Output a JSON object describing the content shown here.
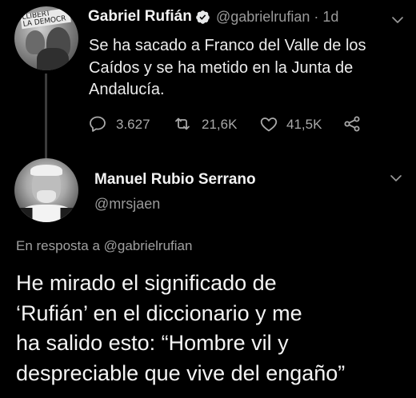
{
  "original_tweet": {
    "author_name": "Gabriel Rufián",
    "handle": "@gabrielrufian",
    "time_separator": "·",
    "timestamp": "1d",
    "avatar_banner_text": "LLIBERT\nLA DEMOCR",
    "text_lines": [
      "Se ha sacado a Franco del Valle de los",
      "Caídos y se ha metido en la Junta de",
      "Andalucía."
    ],
    "actions": {
      "reply_count": "3.627",
      "retweet_count": "21,6K",
      "like_count": "41,5K"
    },
    "icons": [
      "verified-badge-icon",
      "chevron-down-icon",
      "reply-icon",
      "retweet-icon",
      "heart-icon",
      "share-icon"
    ]
  },
  "reply_tweet": {
    "author_name": "Manuel Rubio Serrano",
    "handle": "@mrsjaen",
    "replying_to_label": "En resposta a",
    "replying_to_handle": "@gabrielrufian",
    "text_lines": [
      "He mirado el significado de",
      "‘Rufián’ en el diccionario y me",
      "ha salido esto: “Hombre vil y",
      "despreciable que vive del engaño”"
    ]
  },
  "colors": {
    "background": "#000000",
    "primary_text": "#e7e9ea",
    "secondary_text": "#9a9a9a",
    "thread_line": "#3b3b3b"
  }
}
